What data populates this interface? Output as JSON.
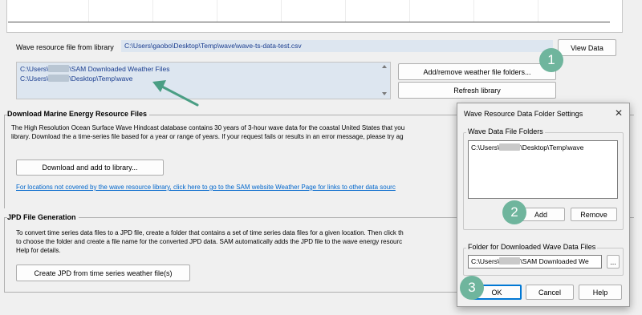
{
  "wave_file": {
    "label": "Wave resource file from library",
    "path": "C:\\Users\\gaobo\\Desktop\\Temp\\wave\\wave-ts-data-test.csv",
    "view_button": "View Data"
  },
  "folders_list": {
    "item1_prefix": "C:\\Users\\",
    "item1_suffix": "\\SAM Downloaded Weather Files",
    "item2_prefix": "C:\\Users\\",
    "item2_suffix": "\\Desktop\\Temp\\wave"
  },
  "library_buttons": {
    "add_remove": "Add/remove weather file folders...",
    "refresh": "Refresh library"
  },
  "download_section": {
    "title": "Download Marine Energy Resource Files",
    "line1": "The High Resolution Ocean Surface Wave Hindcast database contains 30 years of 3-hour wave data for the coastal United States that you",
    "line2": "library. Download the a time-series file based for a year or range of years. If your request fails or results in an error message, please try ag",
    "button": "Download and add to library...",
    "link": "For locations not covered by the wave resource library, click here to go to the SAM website Weather Page for links to other data sourc"
  },
  "jpd_section": {
    "title": "JPD File Generation",
    "line1": "To convert time series data files to a JPD file, create a folder that contains a set of time series data files for a given location. Then click th",
    "line2": "to choose the folder and create a file name for the converted JPD data. SAM automatically adds the JPD file to the wave energy resourc",
    "line3": "Help for details.",
    "button": "Create JPD from time series weather file(s)"
  },
  "dialog": {
    "title": "Wave Resource Data Folder Settings",
    "close_glyph": "✕",
    "folders_group": "Wave Data File Folders",
    "folder_item_prefix": "C:\\Users\\",
    "folder_item_suffix": "\\Desktop\\Temp\\wave",
    "add_button": "Add",
    "remove_button": "Remove",
    "download_group": "Folder for Downloaded Wave Data Files",
    "download_path_prefix": "C:\\Users\\",
    "download_path_suffix": "\\SAM Downloaded We",
    "browse_button": "...",
    "ok_button": "OK",
    "cancel_button": "Cancel",
    "help_button": "Help"
  },
  "badges": {
    "one": "1",
    "two": "2",
    "three": "3"
  },
  "colors": {
    "badge": "#6fb59d",
    "arrow": "#4a9e84",
    "link": "#0066cc",
    "list_bg": "#dde6f0",
    "ok_border": "#0078d4"
  }
}
